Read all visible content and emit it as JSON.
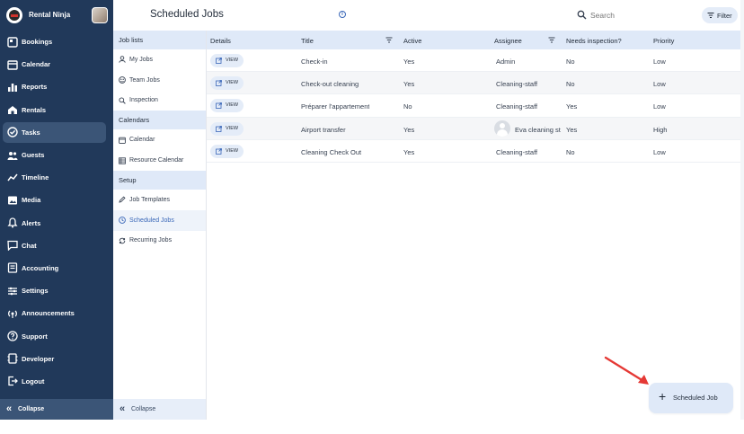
{
  "brand": {
    "name": "Rental Ninja"
  },
  "nav": {
    "items": [
      {
        "label": "Bookings",
        "icon": "bookings-icon",
        "active": false
      },
      {
        "label": "Calendar",
        "icon": "calendar-icon",
        "active": false
      },
      {
        "label": "Reports",
        "icon": "reports-icon",
        "active": false
      },
      {
        "label": "Rentals",
        "icon": "rentals-icon",
        "active": false
      },
      {
        "label": "Tasks",
        "icon": "tasks-icon",
        "active": true
      },
      {
        "label": "Guests",
        "icon": "guests-icon",
        "active": false
      },
      {
        "label": "Timeline",
        "icon": "timeline-icon",
        "active": false
      },
      {
        "label": "Media",
        "icon": "media-icon",
        "active": false
      },
      {
        "label": "Alerts",
        "icon": "alerts-icon",
        "active": false
      },
      {
        "label": "Chat",
        "icon": "chat-icon",
        "active": false
      },
      {
        "label": "Accounting",
        "icon": "accounting-icon",
        "active": false
      },
      {
        "label": "Settings",
        "icon": "settings-icon",
        "active": false
      },
      {
        "label": "Announcements",
        "icon": "announcements-icon",
        "active": false
      },
      {
        "label": "Support",
        "icon": "support-icon",
        "active": false
      },
      {
        "label": "Developer",
        "icon": "developer-icon",
        "active": false
      },
      {
        "label": "Logout",
        "icon": "logout-icon",
        "active": false
      }
    ],
    "collapse_label": "Collapse"
  },
  "subnav": {
    "sections": [
      {
        "header": "Job lists",
        "items": [
          {
            "label": "My Jobs",
            "icon": "user-icon",
            "active": false
          },
          {
            "label": "Team Jobs",
            "icon": "team-icon",
            "active": false
          },
          {
            "label": "Inspection",
            "icon": "search-icon",
            "active": false
          }
        ]
      },
      {
        "header": "Calendars",
        "items": [
          {
            "label": "Calendar",
            "icon": "calendar-icon",
            "active": false
          },
          {
            "label": "Resource Calendar",
            "icon": "grid-icon",
            "active": false
          }
        ]
      },
      {
        "header": "Setup",
        "items": [
          {
            "label": "Job Templates",
            "icon": "pencil-icon",
            "active": false
          },
          {
            "label": "Scheduled Jobs",
            "icon": "clock-icon",
            "active": true
          },
          {
            "label": "Recurring Jobs",
            "icon": "repeat-icon",
            "active": false
          }
        ]
      }
    ],
    "collapse_label": "Collapse"
  },
  "header": {
    "title": "Scheduled Jobs",
    "search_placeholder": "Search",
    "filter_label": "Filter"
  },
  "table": {
    "columns": [
      "Details",
      "Title",
      "Active",
      "Assignee",
      "Needs inspection?",
      "Priority"
    ],
    "view_label": "VIEW",
    "rows": [
      {
        "title": "Check-in",
        "active": "Yes",
        "assignee": "Admin",
        "assignee_avatar": false,
        "inspection": "No",
        "priority": "Low"
      },
      {
        "title": "Check-out cleaning",
        "active": "Yes",
        "assignee": "Cleaning-staff",
        "assignee_avatar": false,
        "inspection": "No",
        "priority": "Low"
      },
      {
        "title": "Préparer l'appartement",
        "active": "No",
        "assignee": "Cleaning-staff",
        "assignee_avatar": false,
        "inspection": "Yes",
        "priority": "Low"
      },
      {
        "title": "Airport transfer",
        "active": "Yes",
        "assignee": "Eva cleaning st",
        "assignee_avatar": true,
        "inspection": "Yes",
        "priority": "High"
      },
      {
        "title": "Cleaning Check Out",
        "active": "Yes",
        "assignee": "Cleaning-staff",
        "assignee_avatar": false,
        "inspection": "No",
        "priority": "Low"
      }
    ]
  },
  "fab": {
    "label": "Scheduled Job"
  },
  "colors": {
    "nav_bg": "#21395a",
    "accent": "#3a67b8",
    "header_bg": "#dfe9f8",
    "arrow": "#e53935"
  }
}
